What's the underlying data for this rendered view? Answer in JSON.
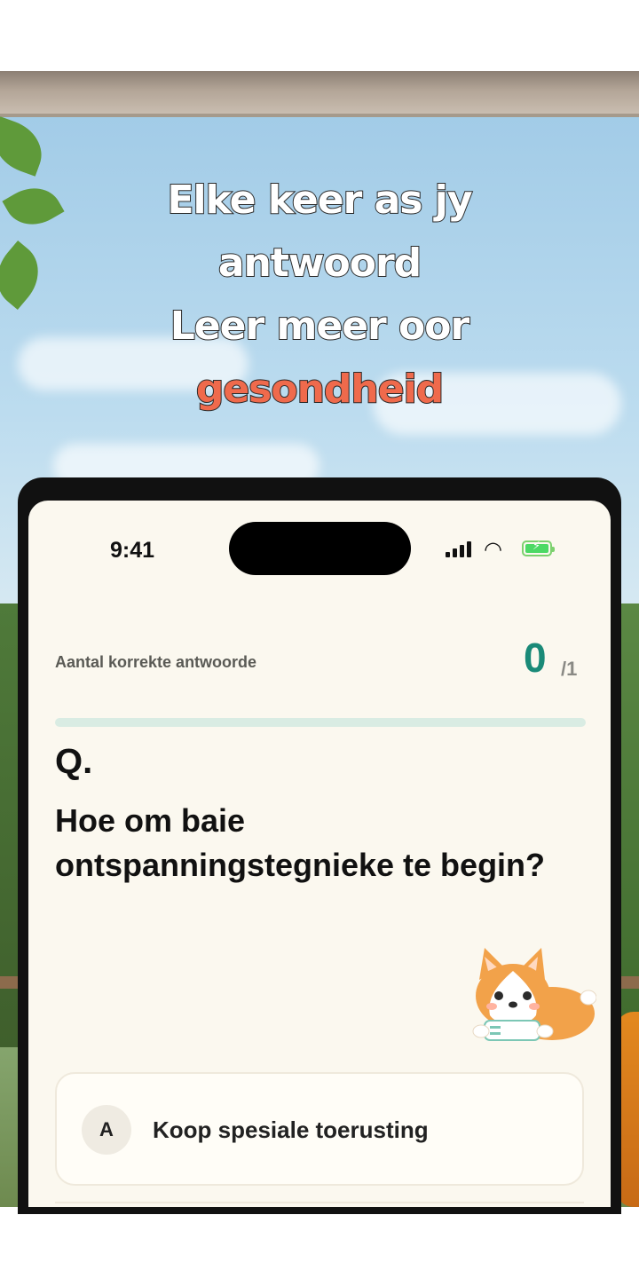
{
  "headline": {
    "line1": "Elke keer as jy",
    "line2": "antwoord",
    "line3": "Leer meer oor",
    "line4": "gesondheid",
    "accent_color": "#ef6a4c"
  },
  "status_bar": {
    "time": "9:41",
    "icons": [
      "signal-icon",
      "wifi-icon",
      "battery-charging-icon"
    ]
  },
  "quiz": {
    "score_label": "Aantal korrekte antwoorde",
    "score_value": "0",
    "score_total": "/1",
    "progress_fraction": 0,
    "q_mark": "Q.",
    "question": "Hoe om baie ontspanningstegnieke te begin?",
    "accent_color": "#1a8a78",
    "answers": [
      {
        "letter": "A",
        "text": "Koop spesiale toerusting"
      }
    ]
  }
}
